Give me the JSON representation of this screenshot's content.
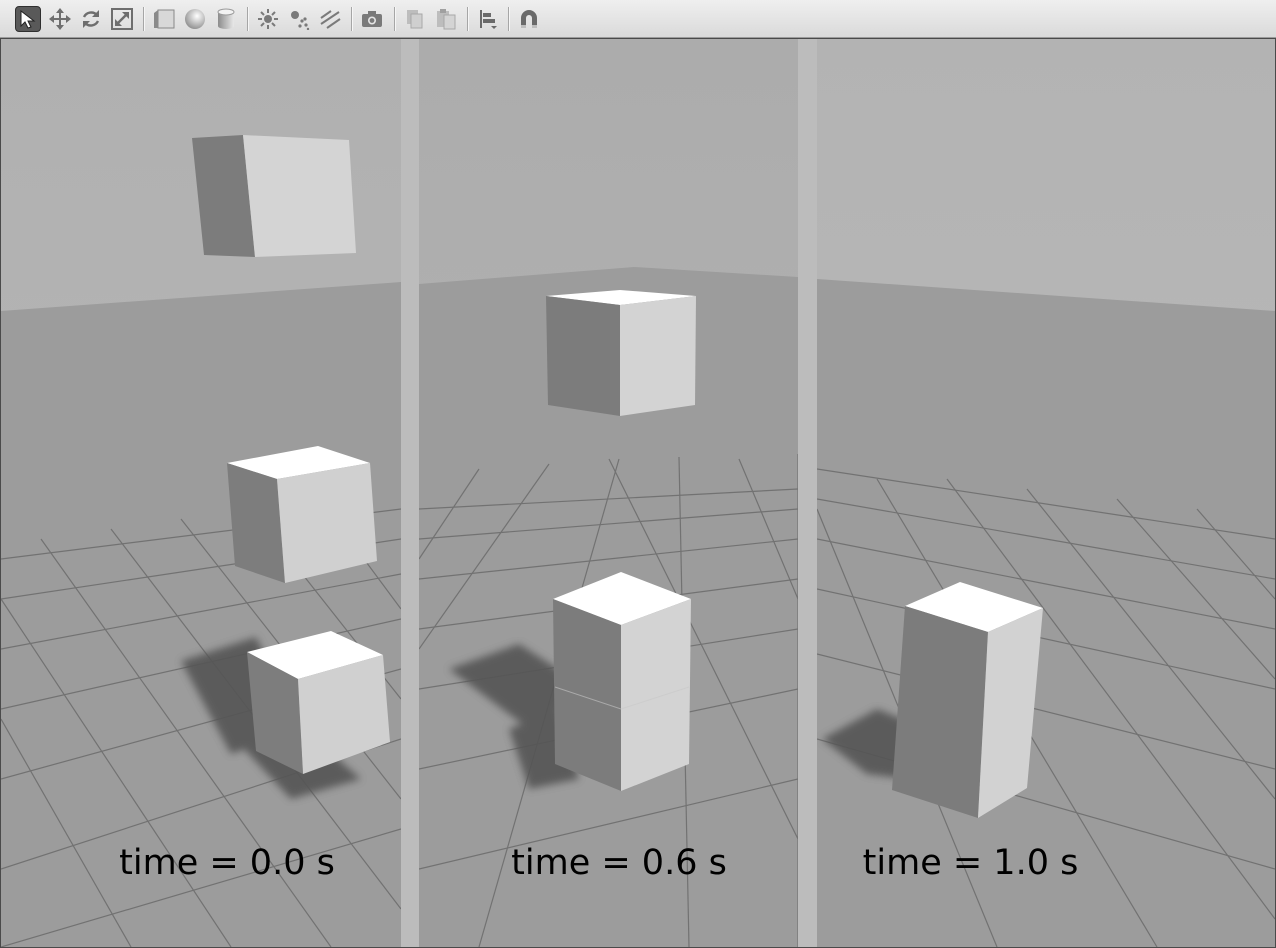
{
  "toolbar": {
    "tools": [
      {
        "name": "select-mode",
        "icon": "cursor-arrow-icon",
        "active": true
      },
      {
        "name": "translate-mode",
        "icon": "move-arrows-icon"
      },
      {
        "name": "rotate-mode",
        "icon": "rotate-arrows-icon"
      },
      {
        "name": "scale-mode",
        "icon": "scale-icon"
      },
      {
        "name": "insert-box",
        "icon": "box-shape-icon"
      },
      {
        "name": "insert-sphere",
        "icon": "sphere-shape-icon"
      },
      {
        "name": "insert-cylinder",
        "icon": "cylinder-shape-icon"
      },
      {
        "name": "point-light",
        "icon": "point-light-icon"
      },
      {
        "name": "spot-light",
        "icon": "spot-light-icon"
      },
      {
        "name": "directional-light",
        "icon": "directional-light-icon"
      },
      {
        "name": "screenshot",
        "icon": "camera-icon"
      },
      {
        "name": "copy",
        "icon": "copy-icon"
      },
      {
        "name": "paste",
        "icon": "paste-icon"
      },
      {
        "name": "align",
        "icon": "align-icon"
      },
      {
        "name": "snap",
        "icon": "magnet-icon"
      }
    ]
  },
  "viewport": {
    "panels": [
      {
        "time_label": "time = 0.0 s"
      },
      {
        "time_label": "time = 0.6 s"
      },
      {
        "time_label": "time = 1.0 s"
      }
    ]
  },
  "colors": {
    "toolbar_bg": "#e6e6e6",
    "sky": "#b4b4b4",
    "ground": "#9e9e9e",
    "box_light": "#d2d2d2",
    "box_dark": "#7d7d7d",
    "box_top": "#ffffff",
    "shadow": "#555555"
  }
}
